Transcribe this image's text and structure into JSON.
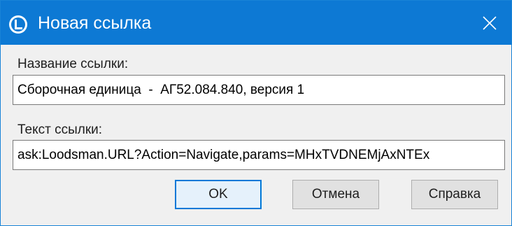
{
  "window": {
    "title": "Новая ссылка",
    "app_icon": "loodsman-logo-icon",
    "close_icon": "close-icon",
    "accent_color": "#0d79d4"
  },
  "form": {
    "name_label": "Название ссылки:",
    "name_value": "Сборочная единица  -  АГ52.084.840, версия 1",
    "text_label": "Текст ссылки:",
    "text_value": "ask:Loodsman.URL?Action=Navigate,params=MHxTVDNEMjAxNTEx"
  },
  "buttons": {
    "ok_label": "OK",
    "cancel_label": "Отмена",
    "help_label": "Справка"
  }
}
